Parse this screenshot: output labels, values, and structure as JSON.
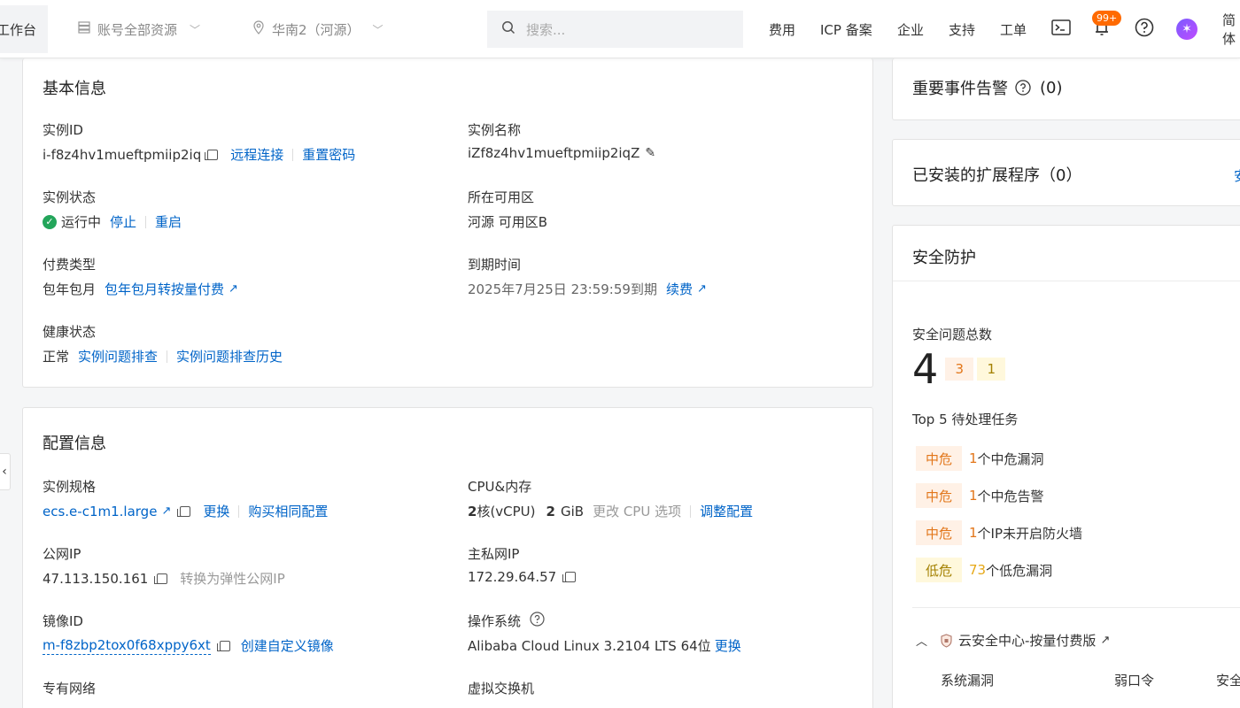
{
  "topbar": {
    "workbench": "工作台",
    "account_selector": "账号全部资源",
    "region_selector": "华南2（河源）",
    "search_placeholder": "搜索...",
    "links": [
      "费用",
      "ICP 备案",
      "企业",
      "支持",
      "工单"
    ],
    "notification_badge": "99+",
    "lang": "简体"
  },
  "basic": {
    "title": "基本信息",
    "instance_id_label": "实例ID",
    "instance_id": "i-f8z4hv1mueftpmiip2iq",
    "remote_connect": "远程连接",
    "reset_password": "重置密码",
    "instance_name_label": "实例名称",
    "instance_name": "iZf8z4hv1mueftpmiip2iqZ",
    "status_label": "实例状态",
    "status": "运行中",
    "stop": "停止",
    "restart": "重启",
    "zone_label": "所在可用区",
    "zone": "河源 可用区B",
    "billing_label": "付费类型",
    "billing": "包年包月",
    "billing_switch": "包年包月转按量付费",
    "expire_label": "到期时间",
    "expire": "2025年7月25日 23:59:59到期",
    "renew": "续费",
    "health_label": "健康状态",
    "health": "正常",
    "diagnose": "实例问题排查",
    "diagnose_history": "实例问题排查历史"
  },
  "config": {
    "title": "配置信息",
    "spec_label": "实例规格",
    "spec": "ecs.e-c1m1.large",
    "change": "更换",
    "buy_same": "购买相同配置",
    "cpu_label": "CPU&内存",
    "cpu_num": "2",
    "cpu_unit": "核(vCPU)",
    "mem_num": "2",
    "mem_unit": "GiB",
    "change_cpu": "更改 CPU 选项",
    "adjust": "调整配置",
    "public_ip_label": "公网IP",
    "public_ip": "47.113.150.161",
    "to_eip": "转换为弹性公网IP",
    "private_ip_label": "主私网IP",
    "private_ip": "172.29.64.57",
    "image_label": "镜像ID",
    "image_id": "m-f8zbp2tox0f68xppy6xt",
    "custom_image": "创建自定义镜像",
    "os_label": "操作系统",
    "os": "Alibaba Cloud Linux 3.2104 LTS 64位",
    "os_change": "更换",
    "vpc_label": "专有网络",
    "vswitch_label": "虚拟交换机"
  },
  "right": {
    "alerts_title": "重要事件告警",
    "alerts_count": "(0)",
    "ext_title": "已安装的扩展程序（0）",
    "ext_action": "安",
    "sec_title": "安全防护",
    "sec_total_label": "安全问题总数",
    "sec_total": "4",
    "sec_mid_count": "3",
    "sec_low_count": "1",
    "top5_label": "Top 5 待处理任务",
    "tasks": [
      {
        "level": "中危",
        "num": "1",
        "text": "个中危漏洞"
      },
      {
        "level": "中危",
        "num": "1",
        "text": "个中危告警"
      },
      {
        "level": "中危",
        "num": "1",
        "text": "个IP未开启防火墙"
      },
      {
        "level": "低危",
        "num": "73",
        "text": "个低危漏洞"
      }
    ],
    "cloud_sec": "云安全中心-按量付费版",
    "col_vuln": "系统漏洞",
    "col_weak": "弱口令",
    "col_third": "安全"
  },
  "colors": {
    "link": "#0064c8",
    "status_ok": "#23a55a",
    "mid_risk": "#e2761a",
    "low_risk": "#e6a817",
    "badge": "#ff6a00"
  }
}
